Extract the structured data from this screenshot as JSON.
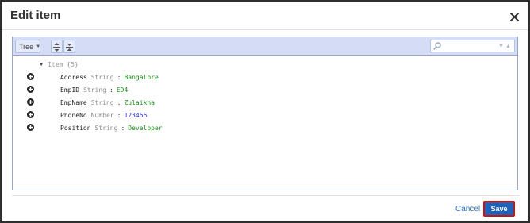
{
  "dialog": {
    "title": "Edit item",
    "close_icon": "close-icon"
  },
  "toolbar": {
    "mode_label": "Tree",
    "mode_icon": "dropdown-arrow-icon",
    "expand_all_icon": "expand-all-icon",
    "collapse_all_icon": "collapse-all-icon",
    "search_placeholder": "",
    "search_icon": "search-icon",
    "next_icon": "search-next-icon",
    "prev_icon": "search-prev-icon"
  },
  "tree": {
    "root_label": "Item {5}",
    "root_toggle_icon": "collapse-triangle-icon",
    "rows": [
      {
        "key": "Address",
        "type": "String",
        "separator": ":",
        "value": "Bangalore",
        "value_kind": "string"
      },
      {
        "key": "EmpID",
        "type": "String",
        "separator": ":",
        "value": "ED4",
        "value_kind": "string"
      },
      {
        "key": "EmpName",
        "type": "String",
        "separator": ":",
        "value": "Zulaikha",
        "value_kind": "string"
      },
      {
        "key": "PhoneNo",
        "type": "Number",
        "separator": ":",
        "value": "123456",
        "value_kind": "number"
      },
      {
        "key": "Position",
        "type": "String",
        "separator": ":",
        "value": "Developer",
        "value_kind": "string"
      }
    ]
  },
  "footer": {
    "cancel_label": "Cancel",
    "save_label": "Save"
  },
  "colors": {
    "toolbar_bg": "#d5ddf6",
    "string_value": "#1c8a1c",
    "number_value": "#3030c8",
    "primary_button": "#1f63b8",
    "highlight_border": "#cc1111",
    "link": "#2a6ebb"
  }
}
